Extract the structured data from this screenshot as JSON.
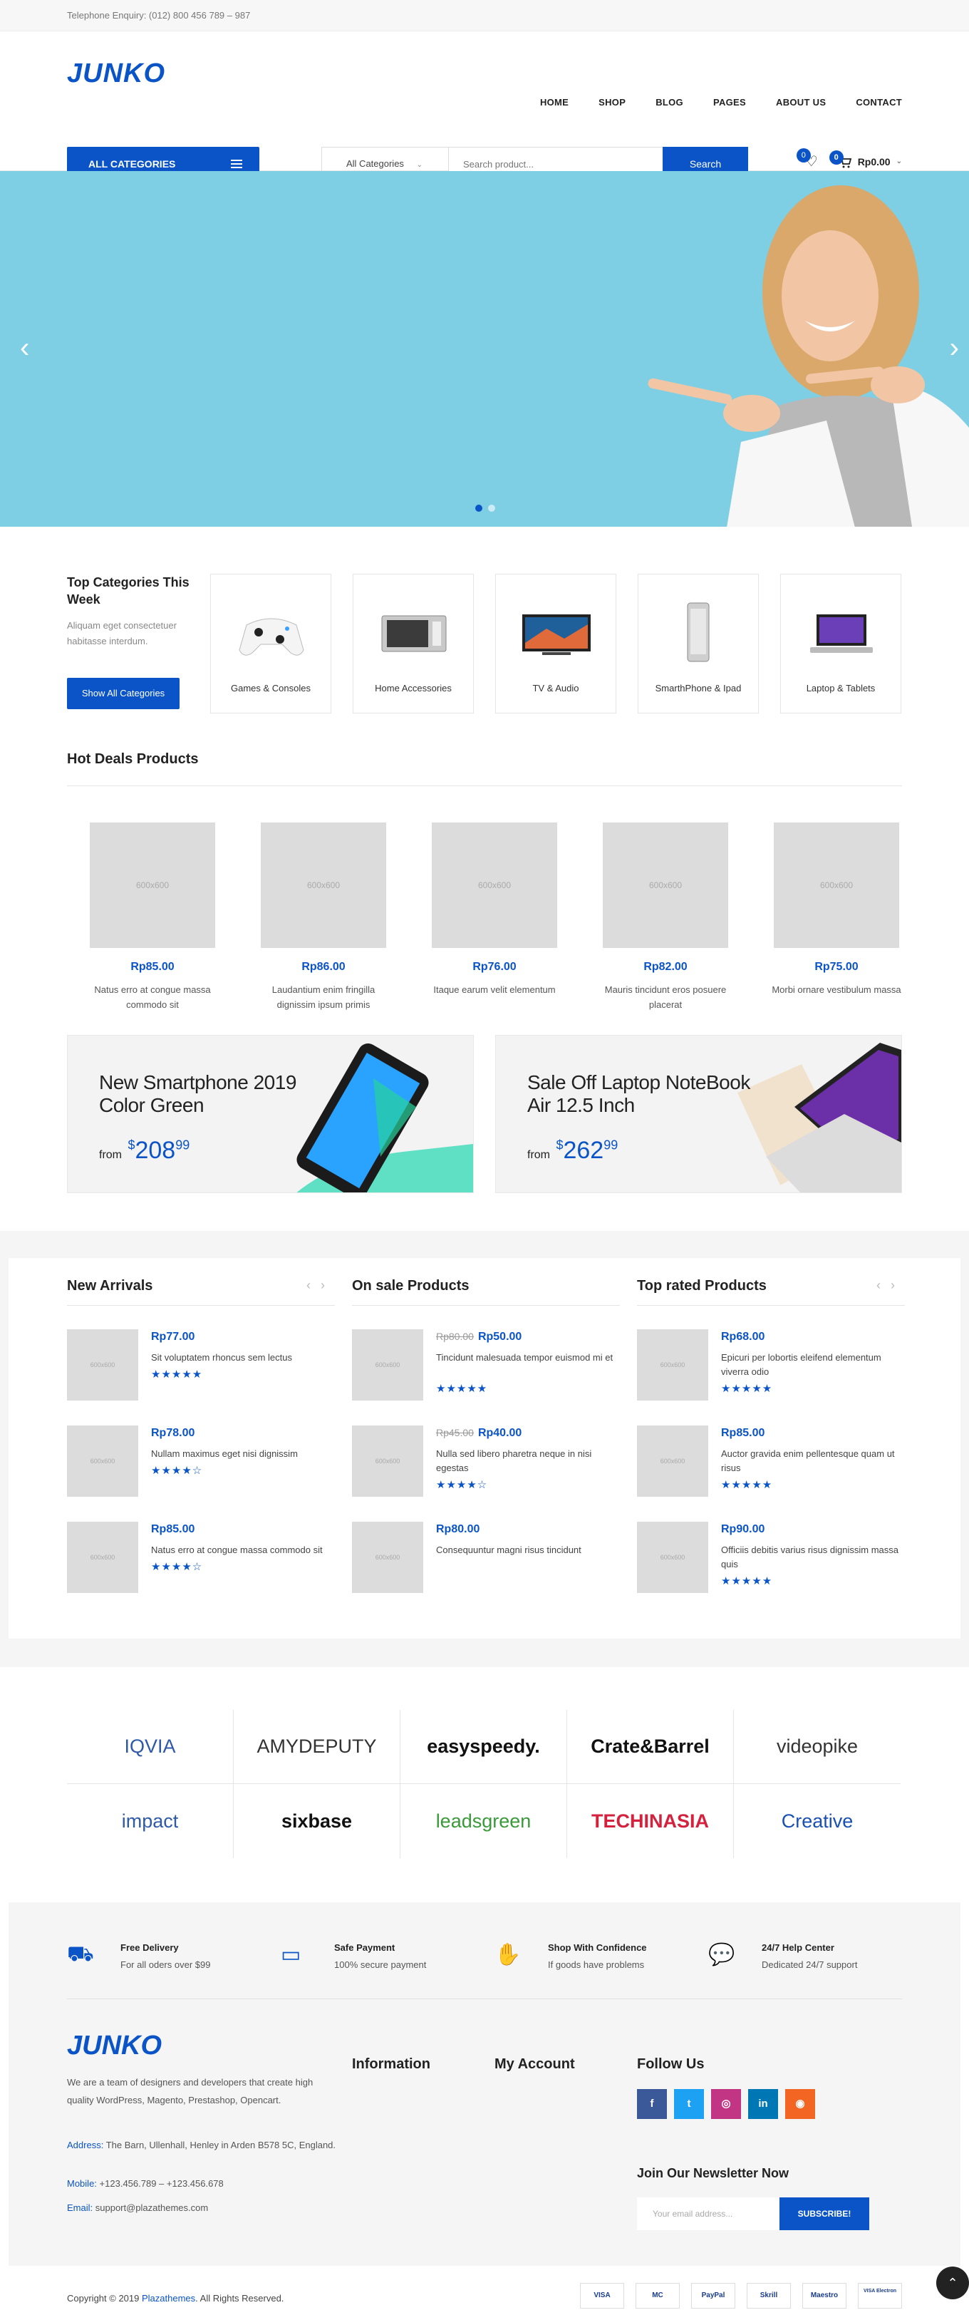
{
  "topbar": {
    "phone": "Telephone Enquiry: (012) 800 456 789 – 987"
  },
  "header": {
    "logo": "JUNKO",
    "nav": [
      "HOME",
      "SHOP",
      "BLOG",
      "PAGES",
      "ABOUT US",
      "CONTACT"
    ],
    "all_categories": "ALL CATEGORIES",
    "search": {
      "category": "All Categories",
      "placeholder": "Search product...",
      "button": "Search"
    },
    "wishlist_count": "0",
    "cart_count": "0",
    "cart_total": "Rp0.00"
  },
  "hero": {
    "prev": "‹",
    "next": "›",
    "active_slide": 1,
    "slide_count": 2
  },
  "categories": {
    "title": "Top Categories This Week",
    "desc": "Aliquam eget consectetuer habitasse interdum.",
    "button": "Show All Categories",
    "items": [
      {
        "label": "Games & Consoles",
        "icon": "gamepad-icon"
      },
      {
        "label": "Home Accessories",
        "icon": "microwave-icon"
      },
      {
        "label": "TV & Audio",
        "icon": "tv-icon"
      },
      {
        "label": "SmarthPhone & Ipad",
        "icon": "phone-icon"
      },
      {
        "label": "Laptop & Tablets",
        "icon": "laptop-icon"
      }
    ]
  },
  "hot_deals": {
    "title": "Hot Deals Products",
    "placeholder": "600x600",
    "items": [
      {
        "price": "Rp85.00",
        "name": "Natus erro at congue massa commodo sit"
      },
      {
        "price": "Rp86.00",
        "name": "Laudantium enim fringilla dignissim ipsum primis"
      },
      {
        "price": "Rp76.00",
        "name": "Itaque earum velit elementum"
      },
      {
        "price": "Rp82.00",
        "name": "Mauris tincidunt eros posuere placerat"
      },
      {
        "price": "Rp75.00",
        "name": "Morbi ornare vestibulum massa"
      }
    ]
  },
  "banners": [
    {
      "title": "New Smartphone 2019 Color Green",
      "from": "from",
      "currency": "$",
      "amount": "208",
      "cents": "99"
    },
    {
      "title": "Sale Off Laptop NoteBook Air 12.5 Inch",
      "from": "from",
      "currency": "$",
      "amount": "262",
      "cents": "99"
    }
  ],
  "columns": [
    {
      "title": "New Arrivals",
      "items": [
        {
          "old": "",
          "price": "Rp77.00",
          "name": "Sit voluptatem rhoncus sem lectus",
          "rating": 5
        },
        {
          "old": "",
          "price": "Rp78.00",
          "name": "Nullam maximus eget nisi dignissim",
          "rating": 4
        },
        {
          "old": "",
          "price": "Rp85.00",
          "name": "Natus erro at congue massa commodo sit",
          "rating": 4
        }
      ]
    },
    {
      "title": "On sale Products",
      "items": [
        {
          "old": "Rp80.00",
          "price": "Rp50.00",
          "name": "Tincidunt malesuada tempor euismod mi et",
          "rating": 5
        },
        {
          "old": "Rp45.00",
          "price": "Rp40.00",
          "name": "Nulla sed libero pharetra neque in nisi egestas",
          "rating": 4
        },
        {
          "old": "",
          "price": "Rp80.00",
          "name": "Consequuntur magni risus tincidunt",
          "rating": 0
        }
      ]
    },
    {
      "title": "Top rated Products",
      "items": [
        {
          "old": "",
          "price": "Rp68.00",
          "name": "Epicuri per lobortis eleifend elementum viverra odio",
          "rating": 5
        },
        {
          "old": "",
          "price": "Rp85.00",
          "name": "Auctor gravida enim pellentesque quam ut risus",
          "rating": 5
        },
        {
          "old": "",
          "price": "Rp90.00",
          "name": "Officiis debitis varius risus dignissim massa quis",
          "rating": 5
        }
      ]
    }
  ],
  "mini_placeholder": "600x600",
  "brands": [
    "IQVIA",
    "AMYDEPUTY",
    "easyspeedy.",
    "Crate&Barrel",
    "videopike",
    "impact",
    "sixbase",
    "leadsgreen",
    "TECHINASIA",
    "Creative"
  ],
  "brand_colors": [
    "#2e5aa8",
    "#333333",
    "#111111",
    "#111111",
    "#333333",
    "#2e5aa8",
    "#111111",
    "#3a9a3a",
    "#d4213d",
    "#1a4fb3"
  ],
  "features": [
    {
      "title": "Free Delivery",
      "sub": "For all oders over $99",
      "icon": "truck-icon"
    },
    {
      "title": "Safe Payment",
      "sub": "100% secure payment",
      "icon": "card-icon"
    },
    {
      "title": "Shop With Confidence",
      "sub": "If goods have problems",
      "icon": "hand-icon"
    },
    {
      "title": "24/7 Help Center",
      "sub": "Dedicated 24/7 support",
      "icon": "chat-icon"
    }
  ],
  "footer": {
    "logo": "JUNKO",
    "desc": "We are a team of designers and developers that create high quality WordPress, Magento, Prestashop, Opencart.",
    "address_label": "Address:",
    "address": "The Barn, Ullenhall, Henley in Arden B578 5C, England.",
    "mobile_label": "Mobile:",
    "mobile": "+123.456.789 – +123.456.678",
    "email_label": "Email:",
    "email": "support@plazathemes.com",
    "info_title": "Information",
    "account_title": "My Account",
    "follow_title": "Follow Us",
    "social": [
      {
        "icon": "facebook-icon",
        "glyph": "f",
        "color": "#3b5998"
      },
      {
        "icon": "twitter-icon",
        "glyph": "t",
        "color": "#1da1f2"
      },
      {
        "icon": "instagram-icon",
        "glyph": "◎",
        "color": "#c13584"
      },
      {
        "icon": "linkedin-icon",
        "glyph": "in",
        "color": "#0077b5"
      },
      {
        "icon": "rss-icon",
        "glyph": "◉",
        "color": "#f26522"
      }
    ],
    "newsletter_title": "Join Our Newsletter Now",
    "newsletter_placeholder": "Your email address...",
    "newsletter_button": "SUBSCRIBE!",
    "copyright_pre": "Copyright © 2019 ",
    "copyright_link": "Plazathemes",
    "copyright_post": ". All Rights Reserved.",
    "payments": [
      "VISA",
      "MC",
      "PayPal",
      "Skrill",
      "Maestro",
      "VISA Electron"
    ]
  },
  "accent": "#0a54c8"
}
